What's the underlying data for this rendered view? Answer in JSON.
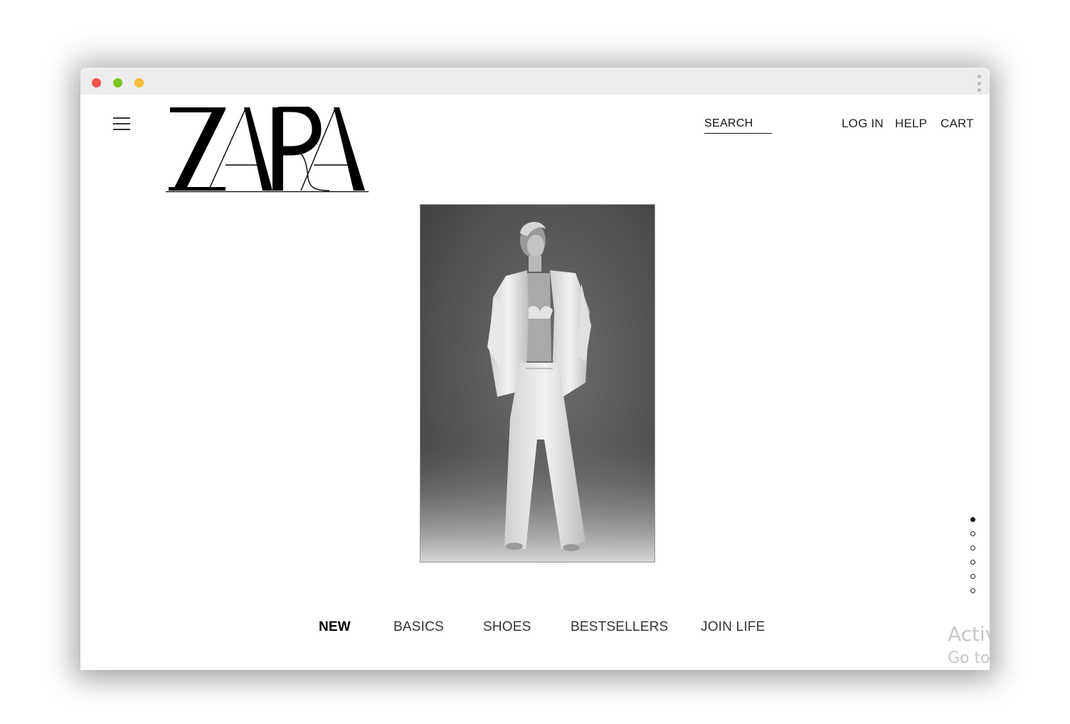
{
  "window": {
    "traffic_lights": [
      "#f2534a",
      "#7cc524",
      "#f7bd35"
    ]
  },
  "header": {
    "logo_text": "ZARA",
    "search_label": "SEARCH",
    "nav": [
      "LOG IN",
      "HELP",
      "CART"
    ]
  },
  "hero": {
    "image_alt": "Model in white suit",
    "slide_count": 6,
    "active_slide": 1
  },
  "categories": [
    {
      "label": "NEW",
      "active": true
    },
    {
      "label": "BASICS",
      "active": false
    },
    {
      "label": "SHOES",
      "active": false
    },
    {
      "label": "BESTSELLERS",
      "active": false
    },
    {
      "label": "JOIN LIFE",
      "active": false
    }
  ],
  "watermark": {
    "line1": "Activ",
    "line2": "Go to"
  },
  "icons": [
    "menu-icon",
    "kebab-menu-icon"
  ]
}
